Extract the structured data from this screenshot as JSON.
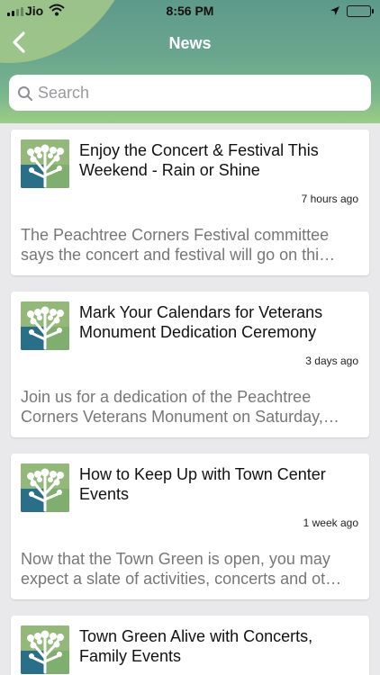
{
  "status_bar": {
    "carrier": "Jio",
    "time": "8:56 PM"
  },
  "header": {
    "title": "News"
  },
  "search": {
    "placeholder": "Search"
  },
  "articles": [
    {
      "title": "Enjoy the Concert & Festival This Weekend - Rain or Shine",
      "time": "7 hours ago",
      "excerpt": "The Peachtree Corners Festival committee says the concert and festival will go on thi…"
    },
    {
      "title": "Mark Your Calendars for Veterans Monument Dedication Ceremony",
      "time": "3 days ago",
      "excerpt": "Join us for a dedication of the Peachtree Corners Veterans Monument on Saturday,…"
    },
    {
      "title": "How to Keep Up with Town Center Events",
      "time": "1 week ago",
      "excerpt": "Now that the Town Green is open, you may expect a slate of activities, concerts and ot…"
    },
    {
      "title": "Town Green Alive with Concerts, Family Events",
      "time": "",
      "excerpt": ""
    }
  ]
}
